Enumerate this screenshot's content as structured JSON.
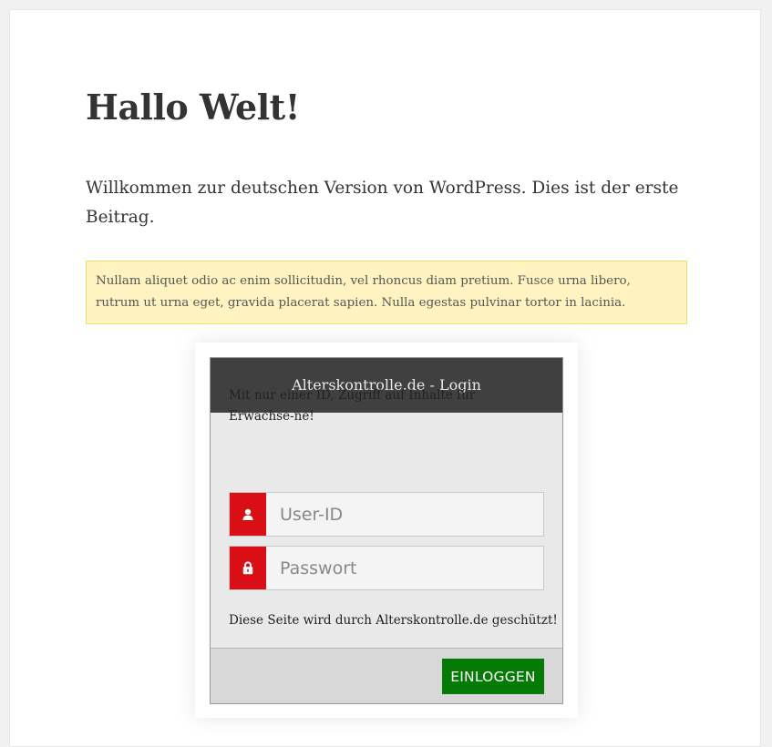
{
  "post": {
    "title": "Hallo Welt!",
    "intro": "Willkommen zur deutschen Version von WordPress. Dies ist der erste Beitrag."
  },
  "notice": {
    "text": "Nullam aliquet odio ac enim sollicitudin, vel rhoncus diam pretium. Fusce urna libero, rutrum ut urna eget, gravida placerat sapien. Nulla egestas pulvinar tortor in lacinia."
  },
  "login": {
    "header": "Alterskontrolle.de - Login",
    "description": "Mit nur einer ID, Zugriff auf Inhalte für Erwachse-ne!",
    "user_field": {
      "placeholder": "User-ID",
      "value": "",
      "icon": "user-icon"
    },
    "password_field": {
      "placeholder": "Passwort",
      "value": "",
      "icon": "lock-icon"
    },
    "protection_note": "Diese Seite wird durch Alterskontrolle.de geschützt!",
    "button_label": "EINLOGGEN"
  },
  "colors": {
    "header_bg": "#404040",
    "icon_red": "#d90f15",
    "button_green": "#067a06",
    "notice_bg": "#fff4c1"
  }
}
